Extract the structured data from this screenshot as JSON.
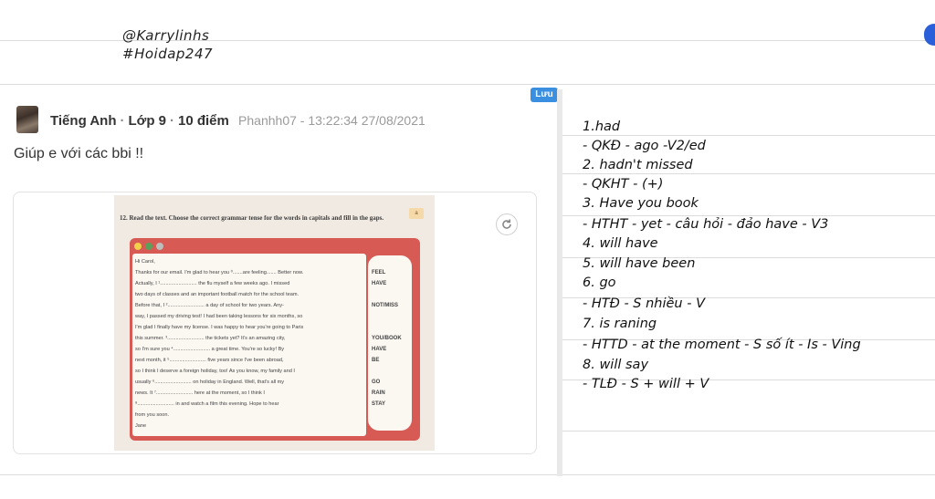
{
  "signature": {
    "handle": "@Karrylinhs",
    "tag": "#Hoidap247"
  },
  "save_badge": "Lưu",
  "post": {
    "subject": "Tiếng Anh",
    "grade": "Lớp 9",
    "points": "10 điểm",
    "author_time": "Phanhh07 - 13:22:34 27/08/2021",
    "question": "Giúp e với các bbi !!"
  },
  "attachment": {
    "title": "12. Read the text. Choose the correct grammar tense for the words in capitals and fill in the gaps.",
    "badge": "a",
    "letter_lines": [
      "Hi Carol,",
      "Thanks for our email. I'm glad to hear you ⁰.......are feeling....... Better now.",
      "Actually, I ¹.......................... the flu myself a few weeks ago. I missed",
      "two days of classes and an important football match for the school team.",
      "Before that, I ².......................... a day of school for two years. Any-",
      "way, I passed my driving test! I had been taking lessons for six months, so",
      "I'm glad I finally have my license. I was happy to hear you're going to Paris",
      "this summer. ³.......................... the tickets yet? It's an amazing city,",
      "so I'm sure you ⁴.......................... a great time. You're so lucky! By",
      "next month, it ⁵.......................... five years since I've been abroad,",
      "so I think I deserve a foreign holiday, too! As you know, my family and I",
      "usually ⁶.......................... on holiday in England. Well, that's all my",
      "news. It ⁷.......................... here at the moment, so I think I",
      "⁸.......................... in and watch a film this evening. Hope to hear",
      "from you soon.",
      "Jane"
    ],
    "cues": [
      "FEEL",
      "HAVE",
      "NOT/MISS",
      "YOU/BOOK",
      "HAVE",
      "BE",
      "GO",
      "RAIN",
      "STAY"
    ]
  },
  "answers": [
    "1.had",
    "- QKĐ - ago -V2/ed",
    "2. hadn't missed",
    "- QKHT - (+)",
    "3. Have you book",
    "- HTHT - yet - câu hỏi - đảo have - V3",
    "4. will have",
    "5. will have been",
    "6. go",
    "- HTĐ - S nhiều - V",
    "7. is raning",
    "- HTTD - at the moment - S số ít - Is - Ving",
    "8. will say",
    "- TLĐ  - S + will + V"
  ],
  "colors": {
    "accent": "#3b8fe0",
    "side_tab": "#2b5fd9",
    "workbook_red": "#d85a54"
  }
}
